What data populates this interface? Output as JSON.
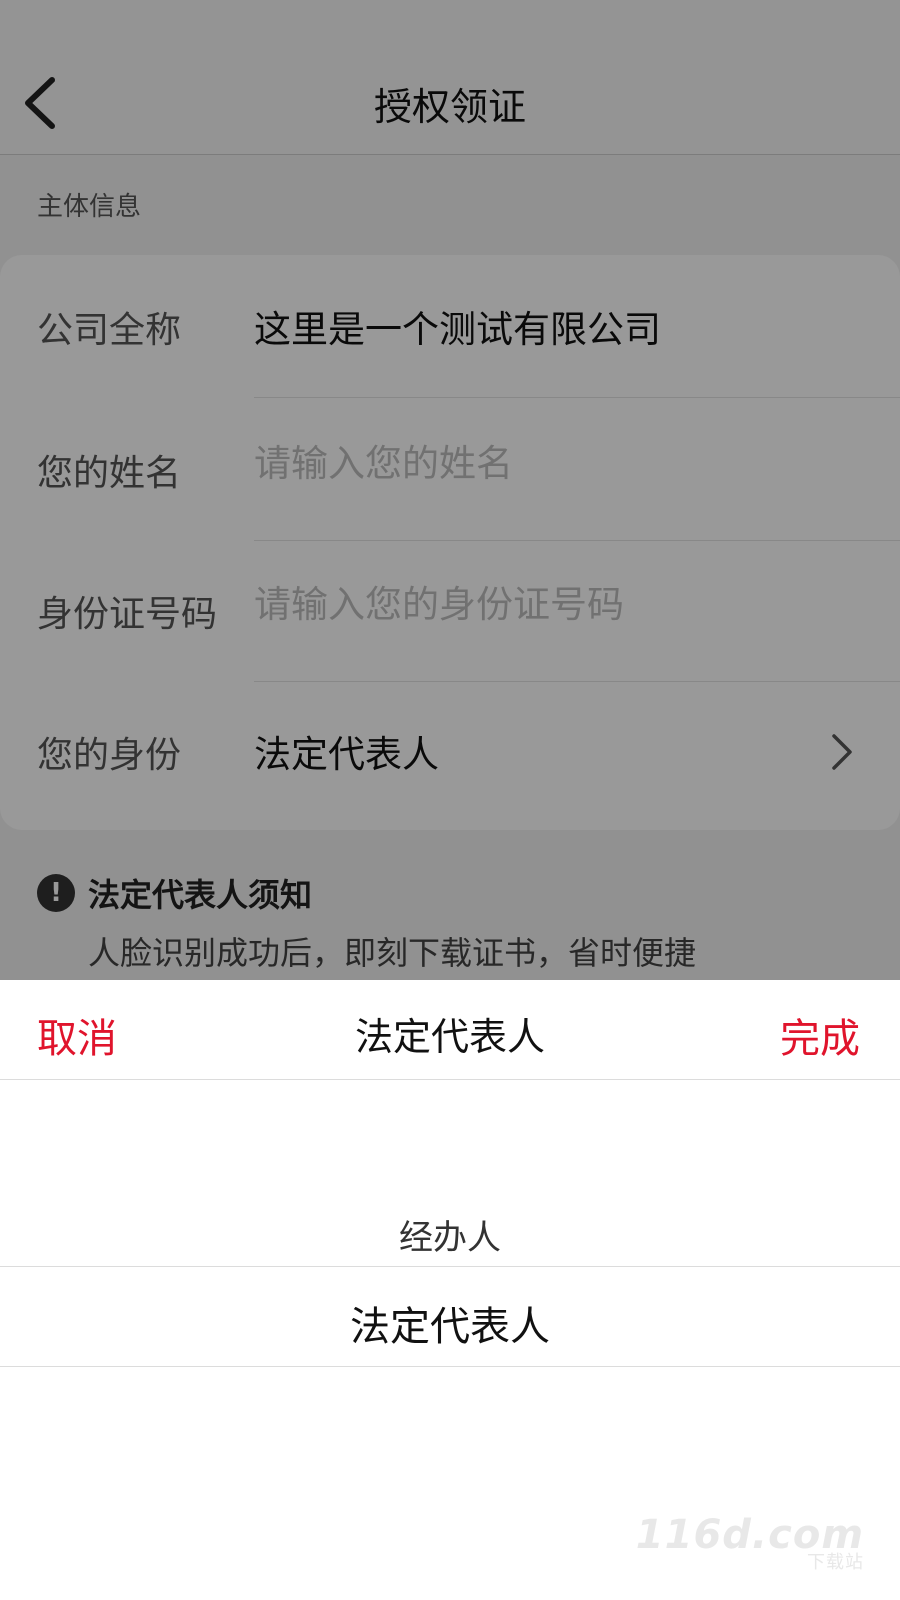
{
  "nav": {
    "title": "授权领证"
  },
  "section": {
    "label": "主体信息"
  },
  "form": {
    "company": {
      "label": "公司全称",
      "value": "这里是一个测试有限公司"
    },
    "name": {
      "label": "您的姓名",
      "value": "",
      "placeholder": "请输入您的姓名"
    },
    "id_number": {
      "label": "身份证号码",
      "value": "",
      "placeholder": "请输入您的身份证号码"
    },
    "identity": {
      "label": "您的身份",
      "value": "法定代表人"
    }
  },
  "notice": {
    "title": "法定代表人须知",
    "text": "人脸识别成功后，即刻下载证书，省时便捷"
  },
  "picker": {
    "cancel_label": "取消",
    "title": "法定代表人",
    "done_label": "完成",
    "options": [
      "经办人",
      "法定代表人"
    ],
    "selected": "法定代表人"
  },
  "colors": {
    "accent": "#e0142c",
    "overlay": "rgba(0,0,0,0.40)"
  },
  "watermark": {
    "main": "116d.com",
    "sub": "下载站"
  }
}
